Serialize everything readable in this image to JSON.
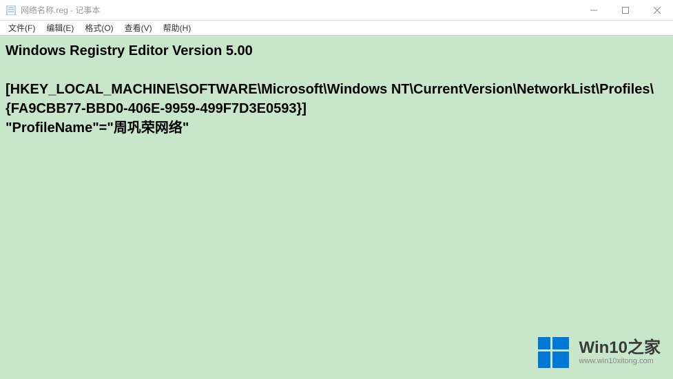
{
  "window": {
    "title": "网络名称.reg - 记事本"
  },
  "menubar": {
    "file": "文件(F)",
    "edit": "编辑(E)",
    "format": "格式(O)",
    "view": "查看(V)",
    "help": "帮助(H)"
  },
  "editor": {
    "line1": "Windows Registry Editor Version 5.00",
    "line2": "[HKEY_LOCAL_MACHINE\\SOFTWARE\\Microsoft\\Windows NT\\CurrentVersion\\NetworkList\\Profiles\\{FA9CBB77-BBD0-406E-9959-499F7D3E0593}]",
    "line3": "\"ProfileName\"=\"周巩荣网络\""
  },
  "watermark": {
    "title": "Win10之家",
    "subtitle": "www.win10xitong.com"
  }
}
